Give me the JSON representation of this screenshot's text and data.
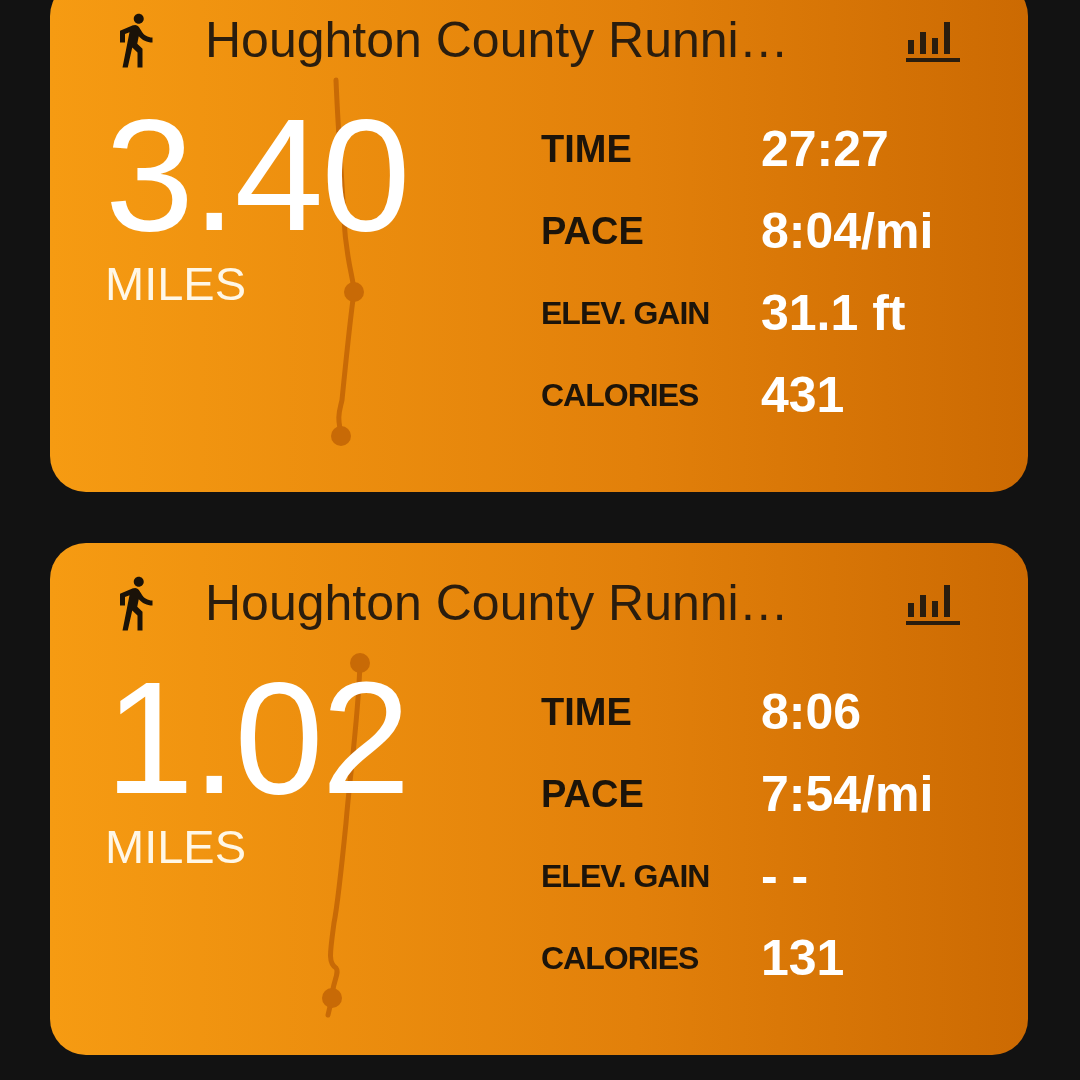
{
  "activities": [
    {
      "title": "Houghton County Runni…",
      "distance": "3.40",
      "unit": "MILES",
      "stats": [
        {
          "label": "TIME",
          "value": "27:27",
          "kind": "large"
        },
        {
          "label": "PACE",
          "value": "8:04/mi",
          "kind": "large"
        },
        {
          "label": "ELEV. GAIN",
          "value": "31.1 ft",
          "kind": "small"
        },
        {
          "label": "CALORIES",
          "value": "431",
          "kind": "small"
        }
      ]
    },
    {
      "title": "Houghton County Runni…",
      "distance": "1.02",
      "unit": "MILES",
      "stats": [
        {
          "label": "TIME",
          "value": "8:06",
          "kind": "large"
        },
        {
          "label": "PACE",
          "value": "7:54/mi",
          "kind": "large"
        },
        {
          "label": "ELEV. GAIN",
          "value": "- -",
          "kind": "small"
        },
        {
          "label": "CALORIES",
          "value": "131",
          "kind": "small"
        }
      ]
    }
  ]
}
